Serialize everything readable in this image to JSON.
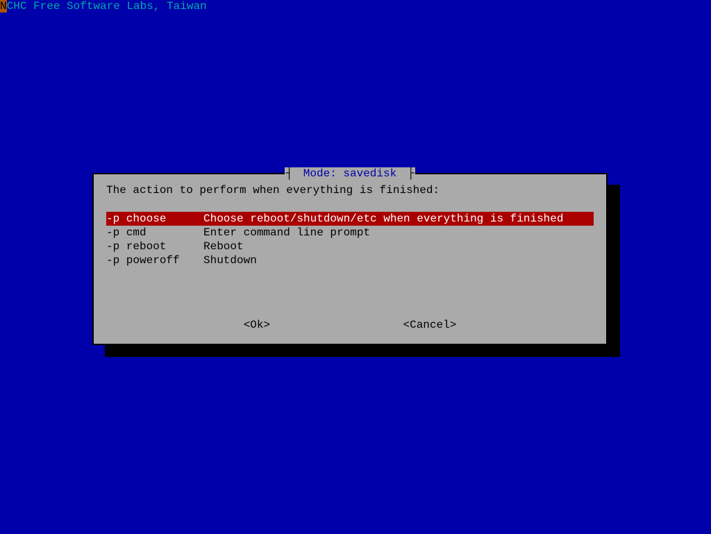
{
  "header": {
    "first_char": "N",
    "rest": "CHC Free Software Labs, Taiwan"
  },
  "dialog": {
    "title_left_bracket": "┤",
    "title": " Mode: savedisk ",
    "title_right_bracket": "├",
    "prompt": "The action to perform when everything is finished:",
    "menu": [
      {
        "opt": "-p choose",
        "desc": "Choose reboot/shutdown/etc when everything is finished",
        "selected": true
      },
      {
        "opt": "-p cmd",
        "desc": "Enter command line prompt",
        "selected": false
      },
      {
        "opt": "-p reboot",
        "desc": "Reboot",
        "selected": false
      },
      {
        "opt": "-p poweroff",
        "desc": "Shutdown",
        "selected": false
      }
    ],
    "buttons": {
      "ok": "<Ok>",
      "cancel": "<Cancel>"
    }
  }
}
